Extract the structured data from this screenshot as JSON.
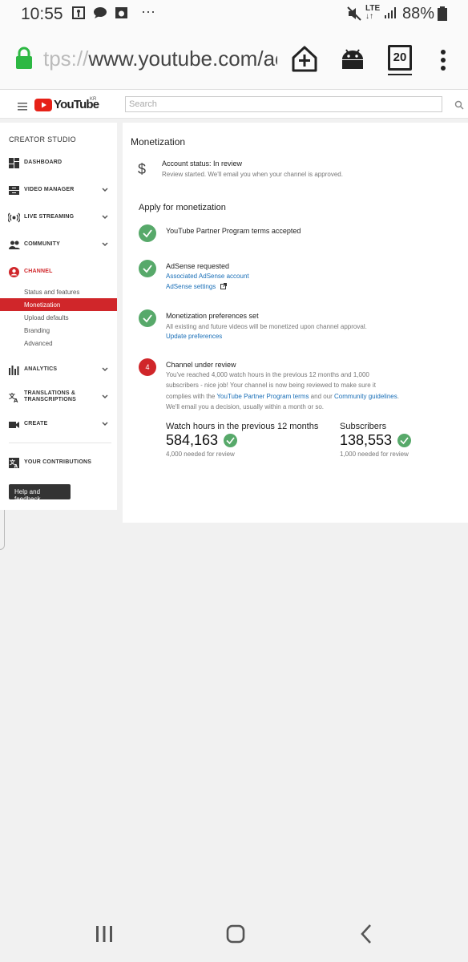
{
  "status_bar": {
    "time": "10:55",
    "signal": "LTE",
    "battery": "88%"
  },
  "browser": {
    "url_faded": "tps://",
    "url_main": "www.youtube.com/ac",
    "tab_count": "20"
  },
  "header": {
    "logo_text": "YouTube",
    "region": "KR",
    "search_placeholder": "Search"
  },
  "sidebar": {
    "title": "CREATOR STUDIO",
    "items": [
      {
        "label": "DASHBOARD"
      },
      {
        "label": "VIDEO MANAGER"
      },
      {
        "label": "LIVE STREAMING"
      },
      {
        "label": "COMMUNITY"
      },
      {
        "label": "CHANNEL"
      },
      {
        "label": "ANALYTICS"
      },
      {
        "label_line1": "TRANSLATIONS &",
        "label_line2": "TRANSCRIPTIONS"
      },
      {
        "label": "CREATE"
      },
      {
        "label": "YOUR CONTRIBUTIONS"
      }
    ],
    "channel_sub": [
      "Status and features",
      "Monetization",
      "Upload defaults",
      "Branding",
      "Advanced"
    ],
    "help_button": "Help and feedback"
  },
  "main": {
    "title": "Monetization",
    "account_status": "Account status: In review",
    "account_desc": "Review started. We'll email you when your channel is approved.",
    "apply_heading": "Apply for monetization",
    "steps": [
      {
        "title": "YouTube Partner Program terms accepted"
      },
      {
        "title": "AdSense requested",
        "link1": "Associated AdSense account",
        "link2": "AdSense settings"
      },
      {
        "title": "Monetization preferences set",
        "desc": "All existing and future videos will be monetized upon channel approval.",
        "link": "Update preferences"
      },
      {
        "number": "4",
        "title": "Channel under review",
        "desc_line1": "You've reached 4,000 watch hours in the previous 12 months and 1,000",
        "desc_line2": "subscribers - nice job! Your channel is now being reviewed to make sure it",
        "desc_line3a": "complies with the ",
        "desc_line3_link1": "YouTube Partner Program terms",
        "desc_line3b": " and our ",
        "desc_line3_link2": "Community guidelines",
        "desc_line3c": ".",
        "desc_line4": "We'll email you a decision, usually within a month or so."
      }
    ],
    "stats": [
      {
        "label": "Watch hours in the previous 12 months",
        "value": "584,163",
        "note": "4,000 needed for review"
      },
      {
        "label": "Subscribers",
        "value": "138,553",
        "note": "1,000 needed for review"
      }
    ]
  },
  "colors": {
    "accent_red": "#d0262a",
    "check_green": "#57a96a",
    "link_blue": "#1a6fb7"
  }
}
